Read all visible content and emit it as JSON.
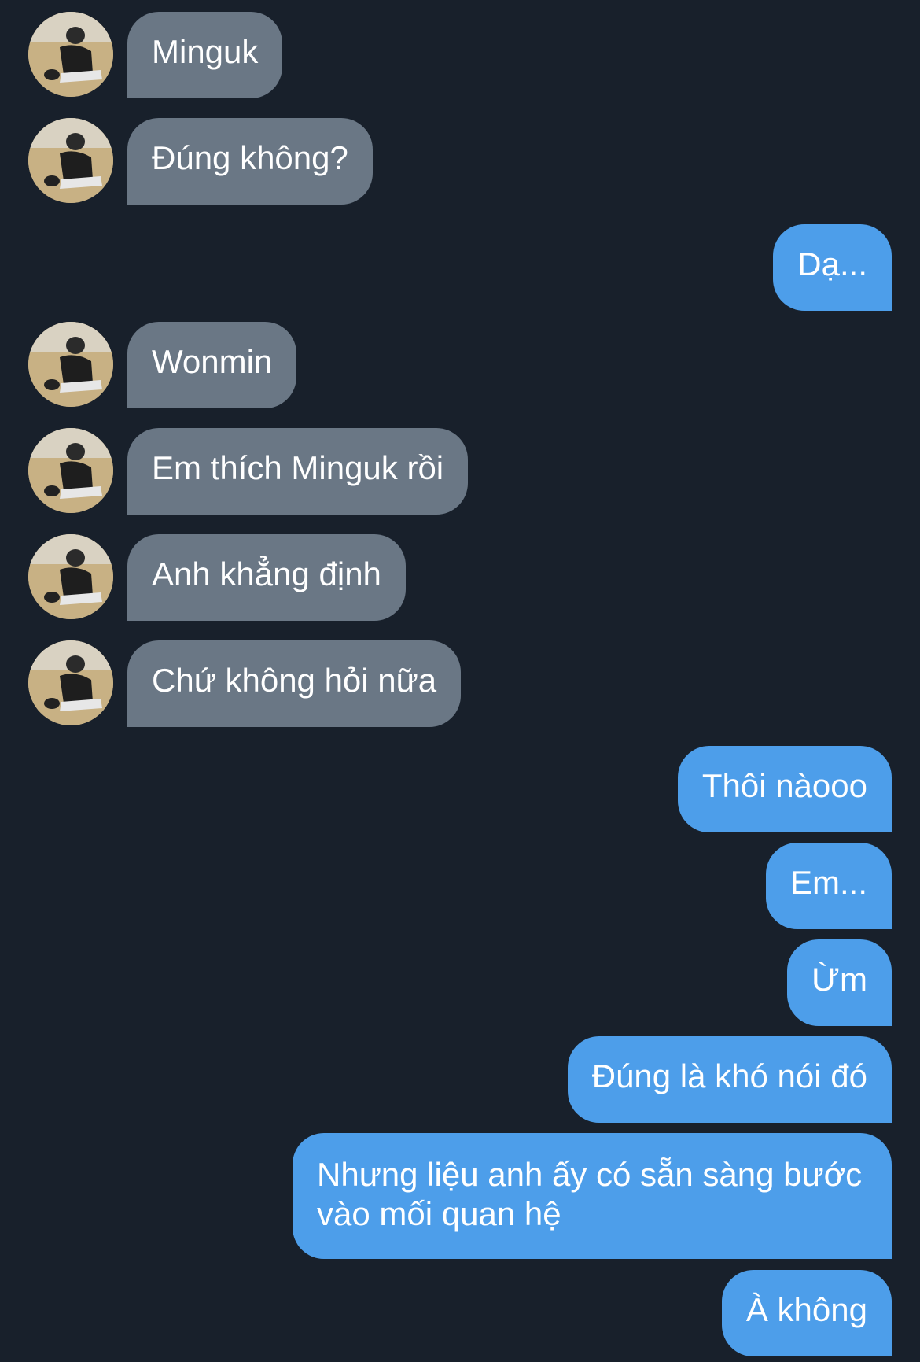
{
  "conversation": {
    "messages": [
      {
        "direction": "incoming",
        "text": "Minguk"
      },
      {
        "direction": "incoming",
        "text": "Đúng không?"
      },
      {
        "direction": "outgoing",
        "text": "Dạ..."
      },
      {
        "direction": "incoming",
        "text": "Wonmin"
      },
      {
        "direction": "incoming",
        "text": "Em thích Minguk rồi"
      },
      {
        "direction": "incoming",
        "text": "Anh khẳng định"
      },
      {
        "direction": "incoming",
        "text": "Chứ không hỏi nữa"
      },
      {
        "direction": "outgoing",
        "text": "Thôi nàooo"
      },
      {
        "direction": "outgoing",
        "text": "Em..."
      },
      {
        "direction": "outgoing",
        "text": "Ừm"
      },
      {
        "direction": "outgoing",
        "text": "Đúng là khó nói đó"
      },
      {
        "direction": "outgoing",
        "text": "Nhưng liệu anh ấy có sẵn sàng bước vào mối quan hệ"
      },
      {
        "direction": "outgoing",
        "text": "À không"
      }
    ]
  },
  "colors": {
    "background": "#18202b",
    "incoming_bubble": "#6a7785",
    "outgoing_bubble": "#4d9eea",
    "text": "#ffffff"
  }
}
